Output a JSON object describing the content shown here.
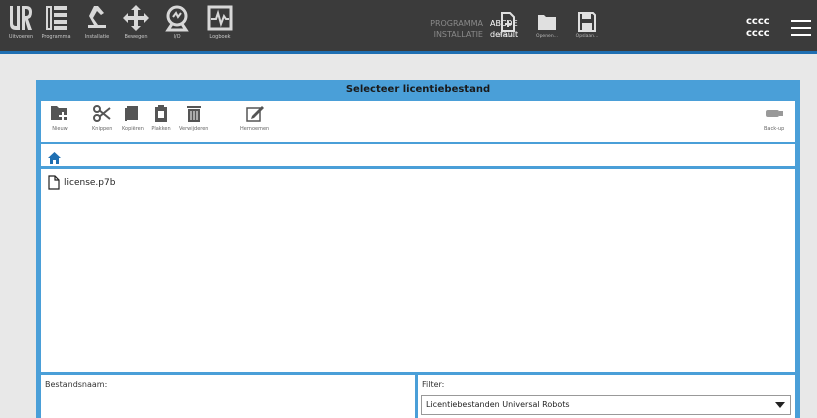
{
  "nav": {
    "items": [
      {
        "label": "Uitvoeren",
        "icon": "ur-logo-icon"
      },
      {
        "label": "Programma",
        "icon": "program-icon"
      },
      {
        "label": "Installatie",
        "icon": "installation-icon"
      },
      {
        "label": "Bewegen",
        "icon": "move-icon"
      },
      {
        "label": "I/O",
        "icon": "io-icon"
      },
      {
        "label": "Logboek",
        "icon": "log-icon"
      }
    ]
  },
  "program": {
    "program_key": "PROGRAMMA",
    "program_value": "ABCDE",
    "installation_key": "INSTALLATIE",
    "installation_value": "default"
  },
  "file_buttons": {
    "new": "Nieuw...",
    "open": "Openen...",
    "save": "Opslaan..."
  },
  "user": {
    "line1": "cccc",
    "line2": "cccc"
  },
  "dialog": {
    "title": "Selecteer licentiebestand",
    "toolbar": {
      "new": "Nieuw",
      "cut": "Knippen",
      "copy": "Kopiëren",
      "paste": "Plakken",
      "delete": "Verwijderen",
      "rename": "Hernoemen",
      "backup": "Back-up"
    },
    "files": [
      {
        "name": "license.p7b",
        "icon": "file-icon"
      }
    ],
    "filename_label": "Bestandsnaam:",
    "filename_value": "",
    "filter_label": "Filter:",
    "filter_value": "Licentiebestanden Universal Robots"
  },
  "colors": {
    "header_bg": "#3b3b3b",
    "accent_blue": "#4a9fd8",
    "header_underline": "#1f6fb2"
  }
}
